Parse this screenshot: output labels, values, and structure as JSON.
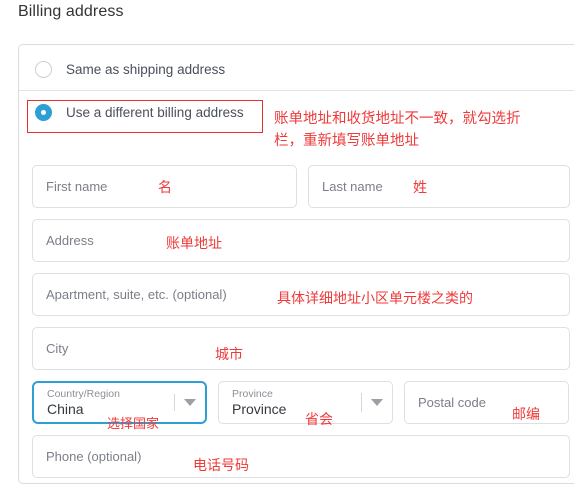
{
  "page_title": "Billing address",
  "options": [
    {
      "label": "Same as shipping address",
      "checked": false
    },
    {
      "label": "Use a different billing address",
      "checked": true
    }
  ],
  "fields": {
    "first_name": "First name",
    "last_name": "Last name",
    "address": "Address",
    "apartment": "Apartment, suite, etc. (optional)",
    "city": "City",
    "country_label": "Country/Region",
    "country_value": "China",
    "province_label": "Province",
    "province_value": "Province",
    "postal_code": "Postal code",
    "phone": "Phone (optional)"
  },
  "annotations": {
    "main_note": "账单地址和收货地址不一致，就勾选折\n栏，重新填写账单地址",
    "first_name": "名",
    "last_name": "姓",
    "address": "账单地址",
    "apartment": "具体详细地址小区单元楼之类的",
    "city": "城市",
    "country": "选择国家",
    "province": "省会",
    "postal_code": "邮编",
    "phone": "电话号码"
  },
  "colors": {
    "accent": "#2e9fd4",
    "annotation": "#ef3a3a",
    "border": "#dfdfdf",
    "text": "#4a4f5c"
  }
}
